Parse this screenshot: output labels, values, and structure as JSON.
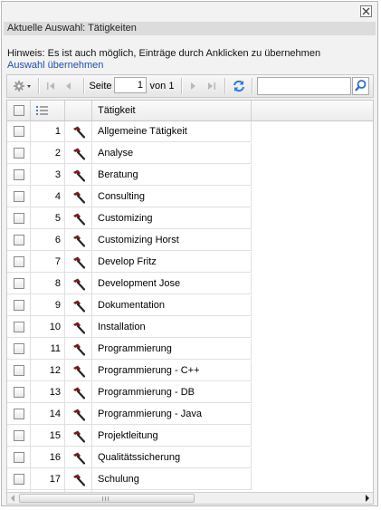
{
  "dialog": {
    "selection_label": "Aktuelle Auswahl: Tätigkeiten",
    "hint_text": "Hinweis: Es ist auch möglich, Einträge durch Anklicken zu übernehmen",
    "apply_link": "Auswahl übernehmen"
  },
  "toolbar": {
    "page_label": "Seite",
    "page_value": "1",
    "of_label": "von 1",
    "search_value": ""
  },
  "grid": {
    "column_header": "Tätigkeit",
    "rows": [
      {
        "num": "1",
        "name": "Allgemeine Tätigkeit"
      },
      {
        "num": "2",
        "name": "Analyse"
      },
      {
        "num": "3",
        "name": "Beratung"
      },
      {
        "num": "4",
        "name": "Consulting"
      },
      {
        "num": "5",
        "name": "Customizing"
      },
      {
        "num": "6",
        "name": "Customizing Horst"
      },
      {
        "num": "7",
        "name": "Develop Fritz"
      },
      {
        "num": "8",
        "name": "Development Jose"
      },
      {
        "num": "9",
        "name": "Dokumentation"
      },
      {
        "num": "10",
        "name": "Installation"
      },
      {
        "num": "11",
        "name": "Programmierung"
      },
      {
        "num": "12",
        "name": "Programmierung - C++"
      },
      {
        "num": "13",
        "name": "Programmierung - DB"
      },
      {
        "num": "14",
        "name": "Programmierung - Java"
      },
      {
        "num": "15",
        "name": "Projektleitung"
      },
      {
        "num": "16",
        "name": "Qualitätssicherung"
      },
      {
        "num": "17",
        "name": "Schulung"
      }
    ]
  },
  "icons": {
    "row_icon": "hammer-icon",
    "hammer_color": "#7a1a1a"
  }
}
